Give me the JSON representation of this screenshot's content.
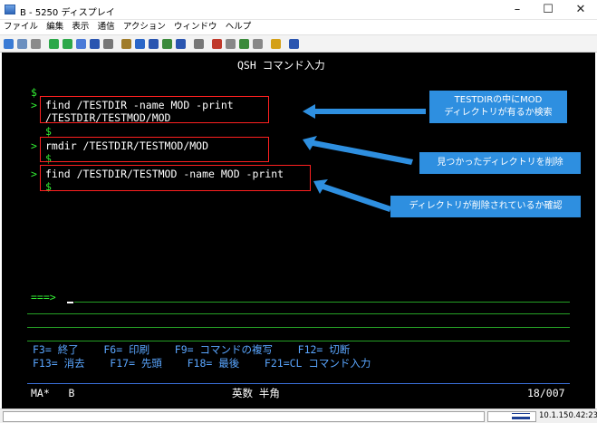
{
  "window": {
    "title": "B - 5250 ディスプレイ",
    "minimize": "–",
    "maximize": "☐",
    "close": "✕"
  },
  "menu": [
    "ファイル",
    "編集",
    "表示",
    "通信",
    "アクション",
    "ウィンドウ",
    "ヘルプ"
  ],
  "toolbar_icons": [
    {
      "name": "print-screen-icon",
      "color": "#3a7bd5"
    },
    {
      "name": "copy-icon",
      "color": "#6b8fbf"
    },
    {
      "name": "paste-icon",
      "color": "#8a8a8a"
    },
    {
      "name": "send-icon",
      "color": "#2da84a"
    },
    {
      "name": "receive-icon",
      "color": "#2da84a"
    },
    {
      "name": "page-icon",
      "color": "#4a7ad8"
    },
    {
      "name": "record-icon",
      "color": "#2a55b0"
    },
    {
      "name": "macro-icon",
      "color": "#777777"
    },
    {
      "name": "clipboard-icon",
      "color": "#a07c2a"
    },
    {
      "name": "color-icon",
      "color": "#2a66c8"
    },
    {
      "name": "keypad-icon",
      "color": "#2a55b0"
    },
    {
      "name": "map-icon",
      "color": "#3b8a3b"
    },
    {
      "name": "grid-icon",
      "color": "#2a55b0"
    },
    {
      "name": "tools-icon",
      "color": "#777777"
    },
    {
      "name": "run-icon",
      "color": "#c0392b"
    },
    {
      "name": "stop-icon",
      "color": "#888888"
    },
    {
      "name": "macro-play-icon",
      "color": "#3b8a3b"
    },
    {
      "name": "macro-stop-icon",
      "color": "#888888"
    },
    {
      "name": "note-icon",
      "color": "#d4a017"
    },
    {
      "name": "help-icon",
      "color": "#2a55b0"
    }
  ],
  "terminal": {
    "header": "QSH コマンド入力",
    "lines": [
      {
        "prompt": " ",
        "text": "$"
      },
      {
        "prompt": ">",
        "text": "find /TESTDIR -name MOD -print"
      },
      {
        "prompt": " ",
        "text": "/TESTDIR/TESTMOD/MOD"
      },
      {
        "prompt": " ",
        "text": "$"
      },
      {
        "prompt": ">",
        "text": "rmdir /TESTDIR/TESTMOD/MOD"
      },
      {
        "prompt": " ",
        "text": "$"
      },
      {
        "prompt": ">",
        "text": "find /TESTDIR/TESTMOD -name MOD -print"
      },
      {
        "prompt": " ",
        "text": "$"
      }
    ],
    "input_prompt": "===>",
    "fkeys_row1": "F3= 終了    F6= 印刷    F9= コマンドの複写    F12= 切断",
    "fkeys_row2": "F13= 消去    F17= 先頭    F18= 最後    F21=CL コマンド入力",
    "status_left": "MA*   B",
    "status_center": "英数 半角",
    "status_right": "18/007"
  },
  "callouts": [
    {
      "line1": "TESTDIRの中にMOD",
      "line2": "ディレクトリが有るか検索"
    },
    {
      "line1": "見つかったディレクトリを削除",
      "line2": ""
    },
    {
      "line1": "ディレクトリが削除されているか確認",
      "line2": ""
    }
  ],
  "statusbar": {
    "ip": "10.1.150.42:23"
  },
  "colors": {
    "terminal_bg": "#000000",
    "terminal_text": "#33ee33",
    "callout_bg": "#2e8fe0",
    "highlight_box": "#ff2020"
  }
}
